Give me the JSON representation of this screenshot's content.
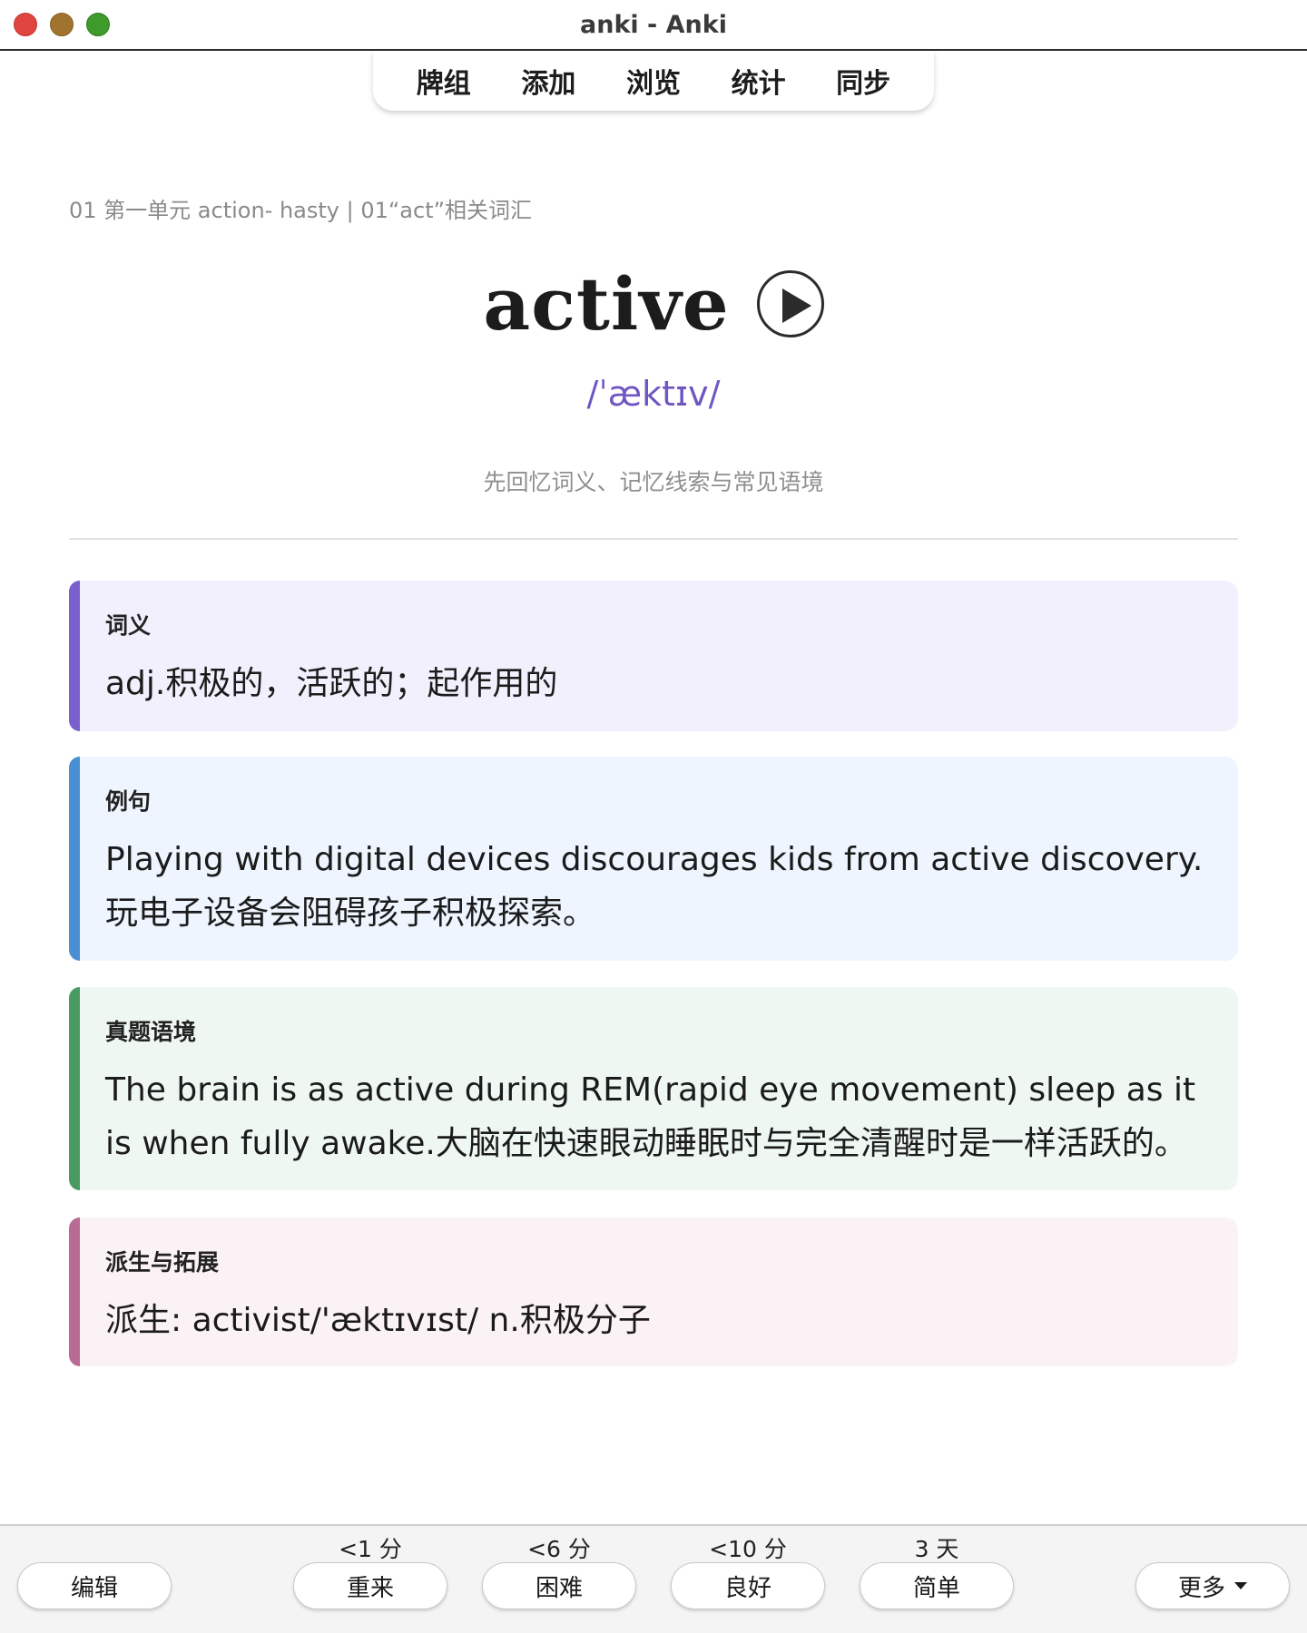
{
  "window": {
    "title": "anki - Anki"
  },
  "toolbar": {
    "items": [
      "牌组",
      "添加",
      "浏览",
      "统计",
      "同步"
    ]
  },
  "card": {
    "breadcrumb": "01 第一单元 action- hasty | 01“act”相关词汇",
    "word": "active",
    "phonetic": "/ˈæktɪv/",
    "hint": "先回忆词义、记忆线索与常见语境",
    "sections": {
      "definition": {
        "label": "词义",
        "content": "adj.积极的，活跃的；起作用的"
      },
      "example": {
        "label": "例句",
        "content": "Playing with digital devices discourages kids from active discovery.玩电子设备会阻碍孩子积极探索。"
      },
      "exam": {
        "label": "真题语境",
        "content": "The brain is as active during REM(rapid eye movement) sleep as it is when fully awake.大脑在快速眼动睡眠时与完全清醒时是一样活跃的。"
      },
      "derivation": {
        "label": "派生与拓展",
        "content": "派生: activist/'æktɪvɪst/ n.积极分子"
      }
    }
  },
  "bottom": {
    "edit": "编辑",
    "more": "更多",
    "answers": [
      {
        "label": "重来",
        "interval": "<1 分"
      },
      {
        "label": "困难",
        "interval": "<6 分"
      },
      {
        "label": "良好",
        "interval": "<10 分"
      },
      {
        "label": "简单",
        "interval": "3 天"
      }
    ]
  },
  "colors": {
    "phonetic": "#6e57c2",
    "definition_accent": "#7b5fcf",
    "example_accent": "#4a8fd4",
    "exam_accent": "#4a9a63",
    "derivation_accent": "#b86b93"
  },
  "icons": {
    "play": "play-icon",
    "more_caret": "chevron-down-icon"
  }
}
